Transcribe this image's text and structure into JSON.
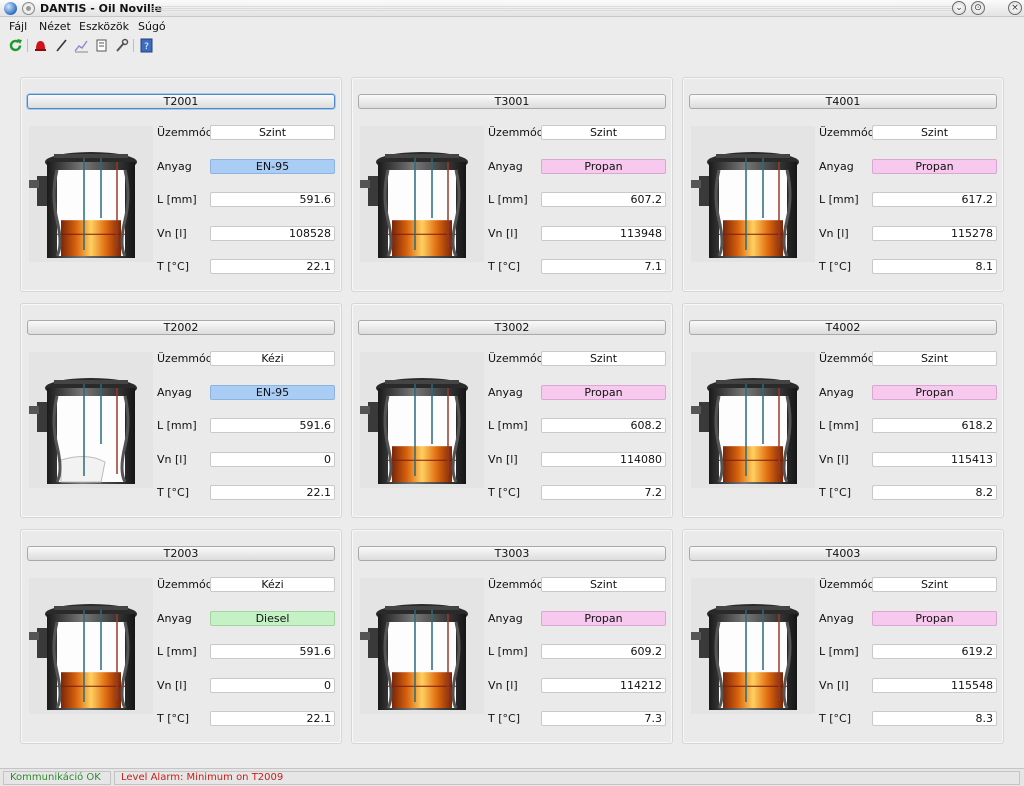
{
  "window": {
    "title": "DANTIS - Oil Noville"
  },
  "menu": [
    "Fájl",
    "Nézet",
    "Eszközök",
    "Súgó"
  ],
  "toolbar": {
    "icons": [
      "refresh-icon",
      "alarm-bell-icon",
      "pen-icon",
      "chart-icon",
      "report-icon",
      "wrench-icon",
      "help-icon"
    ]
  },
  "labels": {
    "mode": "Üzemmód",
    "material": "Anyag",
    "level": "L [mm]",
    "volume": "Vn [l]",
    "temp": "T [°C]"
  },
  "colors": {
    "en95": "#a9cdf4",
    "propan": "#f7c9ef",
    "diesel": "#c4f2c4"
  },
  "tanks": [
    {
      "name": "T2001",
      "mode": "Szint",
      "material": "EN-95",
      "material_key": "en95",
      "level": "591.6",
      "volume": "108528",
      "temp": "22.1",
      "fill": 0.42,
      "focused": true
    },
    {
      "name": "T3001",
      "mode": "Szint",
      "material": "Propan",
      "material_key": "propan",
      "level": "607.2",
      "volume": "113948",
      "temp": "7.1",
      "fill": 0.42
    },
    {
      "name": "T4001",
      "mode": "Szint",
      "material": "Propan",
      "material_key": "propan",
      "level": "617.2",
      "volume": "115278",
      "temp": "8.1",
      "fill": 0.42
    },
    {
      "name": "T2002",
      "mode": "Kézi",
      "material": "EN-95",
      "material_key": "en95",
      "level": "591.6",
      "volume": "0",
      "temp": "22.1",
      "fill": 0
    },
    {
      "name": "T3002",
      "mode": "Szint",
      "material": "Propan",
      "material_key": "propan",
      "level": "608.2",
      "volume": "114080",
      "temp": "7.2",
      "fill": 0.42
    },
    {
      "name": "T4002",
      "mode": "Szint",
      "material": "Propan",
      "material_key": "propan",
      "level": "618.2",
      "volume": "115413",
      "temp": "8.2",
      "fill": 0.42
    },
    {
      "name": "T2003",
      "mode": "Kézi",
      "material": "Diesel",
      "material_key": "diesel",
      "level": "591.6",
      "volume": "0",
      "temp": "22.1",
      "fill": 0.42
    },
    {
      "name": "T3003",
      "mode": "Szint",
      "material": "Propan",
      "material_key": "propan",
      "level": "609.2",
      "volume": "114212",
      "temp": "7.3",
      "fill": 0.42
    },
    {
      "name": "T4003",
      "mode": "Szint",
      "material": "Propan",
      "material_key": "propan",
      "level": "619.2",
      "volume": "115548",
      "temp": "8.3",
      "fill": 0.42
    }
  ],
  "status": {
    "comm": "Kommunikáció OK",
    "comm_color": "#2e8b2e",
    "alarm": "Level Alarm: Minimum on T2009",
    "alarm_color": "#c8201a"
  }
}
